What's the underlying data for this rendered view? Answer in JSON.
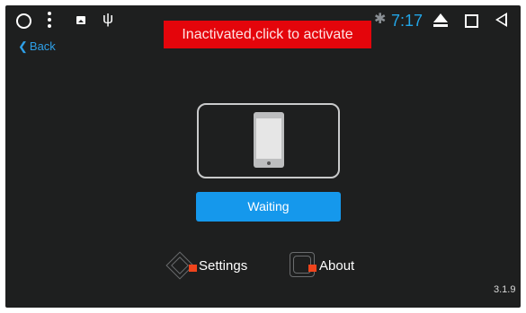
{
  "status_bar": {
    "time": "7:17",
    "icons": [
      "circle-home-icon",
      "more-vert-icon",
      "image-icon",
      "usb-icon",
      "bluetooth-icon",
      "eject-icon",
      "recents-square-icon",
      "back-triangle-icon"
    ]
  },
  "banner": {
    "text": "Inactivated,click to activate",
    "color": "#e4050b"
  },
  "nav": {
    "back_label": "Back",
    "back_glyph": "❮"
  },
  "device": {
    "icon": "phone-icon"
  },
  "status_button": {
    "label": "Waiting",
    "color": "#1598ec"
  },
  "menu": {
    "settings_label": "Settings",
    "about_label": "About"
  },
  "version": "3.1.9",
  "colors": {
    "background": "#1e1f1f",
    "accent": "#22a5e6",
    "marker": "#f0441c"
  }
}
